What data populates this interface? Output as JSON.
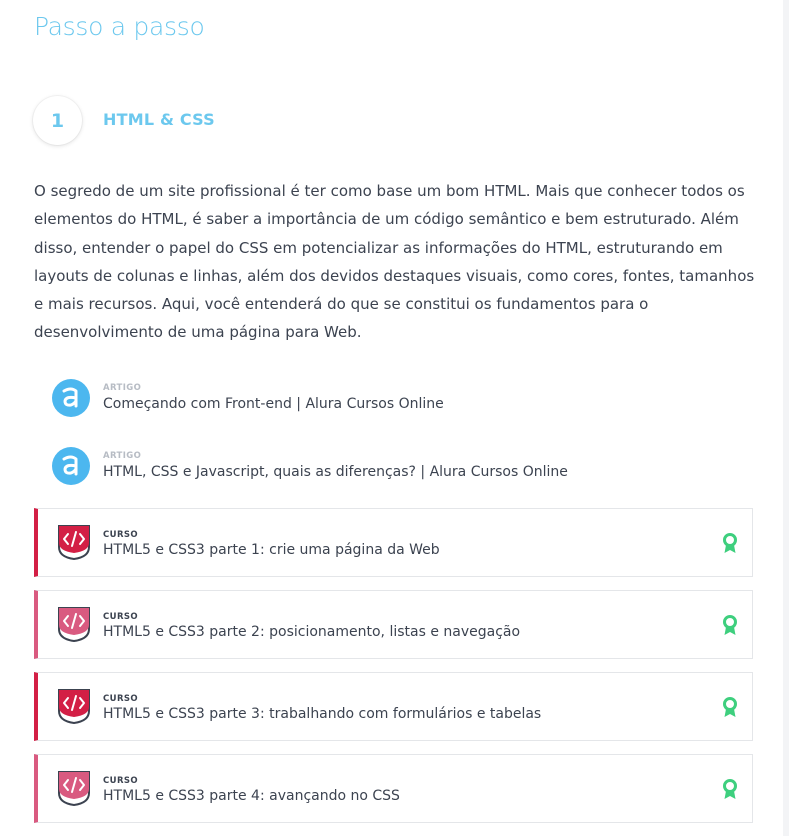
{
  "page_title": "Passo a passo",
  "step": {
    "number": "1",
    "title": "HTML & CSS",
    "description": "O segredo de um site profissional é ter como base um bom HTML. Mais que conhecer todos os elementos do HTML, é saber a importância de um código semântico e bem estruturado. Além disso, entender o papel do CSS em potencializar as informações do HTML, estruturando em layouts de colunas e linhas, além dos devidos destaques visuais, como cores, fontes, tamanhos e mais recursos. Aqui, você entenderá do que se constitui os fundamentos para o desenvolvimento de uma página para Web."
  },
  "articles": [
    {
      "kind": "ARTIGO",
      "title": "Começando com Front-end | Alura Cursos Online",
      "icon": "alura-logo-icon"
    },
    {
      "kind": "ARTIGO",
      "title": "HTML, CSS e Javascript, quais as diferenças? | Alura Cursos Online",
      "icon": "alura-logo-icon"
    }
  ],
  "courses": [
    {
      "kind": "CURSO",
      "title": "HTML5 e CSS3 parte 1: crie uma página da Web",
      "icon": "code-badge-icon",
      "status_icon": "award-icon"
    },
    {
      "kind": "CURSO",
      "title": "HTML5 e CSS3 parte 2: posicionamento, listas e navegação",
      "icon": "code-badge-icon",
      "status_icon": "award-icon"
    },
    {
      "kind": "CURSO",
      "title": "HTML5 e CSS3 parte 3: trabalhando com formulários e tabelas",
      "icon": "code-badge-icon",
      "status_icon": "award-icon"
    },
    {
      "kind": "CURSO",
      "title": "HTML5 e CSS3 parte 4: avançando no CSS",
      "icon": "code-badge-icon",
      "status_icon": "award-icon"
    }
  ],
  "colors": {
    "accent": "#6cc8ee",
    "text": "#3c4350",
    "alura_blue": "#4cb7ef",
    "course_red": "#d31f45",
    "course_pink": "#d95a80",
    "badge_green": "#3ecf7e"
  }
}
